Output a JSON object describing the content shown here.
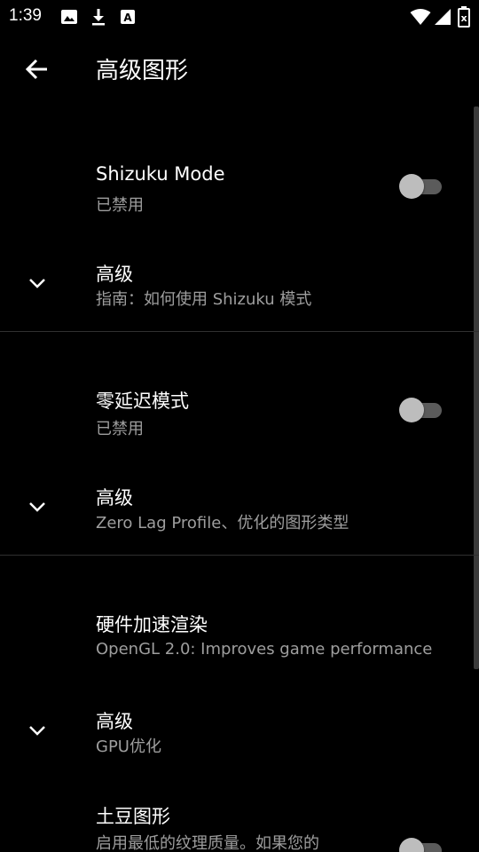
{
  "status_bar": {
    "time": "1:39",
    "icons": [
      "image-icon",
      "download-icon",
      "a-box-icon",
      "wifi-icon",
      "signal-icon",
      "battery-icon"
    ]
  },
  "app_bar": {
    "back_icon": "arrow-left-icon",
    "title": "高级图形"
  },
  "sections": [
    {
      "title": "Shizuku Mode",
      "summary": "已禁用",
      "switch_on": false,
      "advanced_title": "高级",
      "advanced_summary": "指南：如何使用 Shizuku 模式"
    },
    {
      "title": "零延迟模式",
      "summary": "已禁用",
      "switch_on": false,
      "advanced_title": "高级",
      "advanced_summary": "Zero Lag Profile、优化的图形类型"
    },
    {
      "title": "硬件加速渲染",
      "summary": "OpenGL 2.0: Improves game performance",
      "advanced_title": "高级",
      "advanced_summary": "GPU优化"
    },
    {
      "title": "土豆图形",
      "summary": "启用最低的纹理质量。如果您的",
      "switch_on": false
    }
  ],
  "colors": {
    "background": "#000000",
    "text_primary": "#ffffff",
    "text_secondary": "#9e9e9e",
    "divider": "#303030",
    "switch_thumb_off": "#bdbdbd",
    "switch_track_off": "#5b5b5b"
  }
}
